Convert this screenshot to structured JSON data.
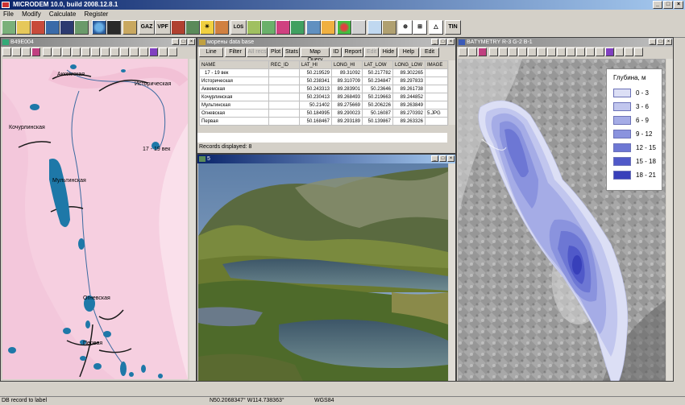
{
  "app": {
    "title": "MICRODEM 10.0, build 2008.12.8.1"
  },
  "menu": [
    "File",
    "Modify",
    "Calculate",
    "Register"
  ],
  "toolbar": {
    "gaz": "GAZ",
    "vpf": "VPF",
    "los": "LOS",
    "tin": "TIN"
  },
  "left_window": {
    "title": "B49E004",
    "labels": {
      "akkem": "Аккемская",
      "istoricheskaya": "Историческая",
      "kochurlinskaya": "Кочурлинская",
      "century": "17 - 19 век",
      "multinskaya": "Мультинская",
      "ognevskaya": "Огневская",
      "pervaya": "Первая"
    }
  },
  "db_window": {
    "title": "морены data base",
    "buttons": [
      "Line",
      "Filter",
      "All recs",
      "Plot",
      "Stats",
      "Map Query",
      "ID",
      "Report",
      "Edit",
      "Hide",
      "Help",
      "Edit"
    ],
    "columns": [
      "NAME",
      "REC_ID",
      "LAT_HI",
      "LONG_HI",
      "LAT_LOW",
      "LONG_LOW",
      "IMAGE"
    ],
    "rows": [
      [
        "17 - 19 век",
        "",
        "50.219529",
        "89.31092",
        "50.217782",
        "89.302265",
        ""
      ],
      [
        "Историческая",
        "",
        "50.238341",
        "89.310709",
        "50.234847",
        "89.297833",
        ""
      ],
      [
        "Аккемская",
        "",
        "50.243313",
        "89.283901",
        "50.23646",
        "89.261738",
        ""
      ],
      [
        "Кочурлинская",
        "",
        "50.230413",
        "89.268493",
        "50.219663",
        "89.244852",
        ""
      ],
      [
        "Мультинская",
        "",
        "50.21402",
        "89.275669",
        "50.206226",
        "89.263849",
        ""
      ],
      [
        "Огневская",
        "",
        "50.184995",
        "89.290023",
        "50.16087",
        "89.270392",
        "5.JPG"
      ],
      [
        "Первая",
        "",
        "50.168467",
        "89.293189",
        "50.139867",
        "89.263326",
        ""
      ]
    ],
    "records": "Records displayed: 8"
  },
  "photo_window": {
    "title": "5"
  },
  "right_window": {
    "title": "BATYMETRY R-3 G-2 B-1"
  },
  "legend": {
    "title": "Глубина, м",
    "items": [
      {
        "label": "0 - 3",
        "color": "#dcdff5"
      },
      {
        "label": "3 - 6",
        "color": "#c1c6ee"
      },
      {
        "label": "6 - 9",
        "color": "#a5ace6"
      },
      {
        "label": "9 - 12",
        "color": "#8a93de"
      },
      {
        "label": "12 - 15",
        "color": "#6d77d4"
      },
      {
        "label": "15 - 18",
        "color": "#5059c9"
      },
      {
        "label": "18 - 21",
        "color": "#3840ba"
      }
    ]
  },
  "status": {
    "left": "DB record to label",
    "coords": "N50.2068347° W114.738363°",
    "datum": "WGS84"
  }
}
